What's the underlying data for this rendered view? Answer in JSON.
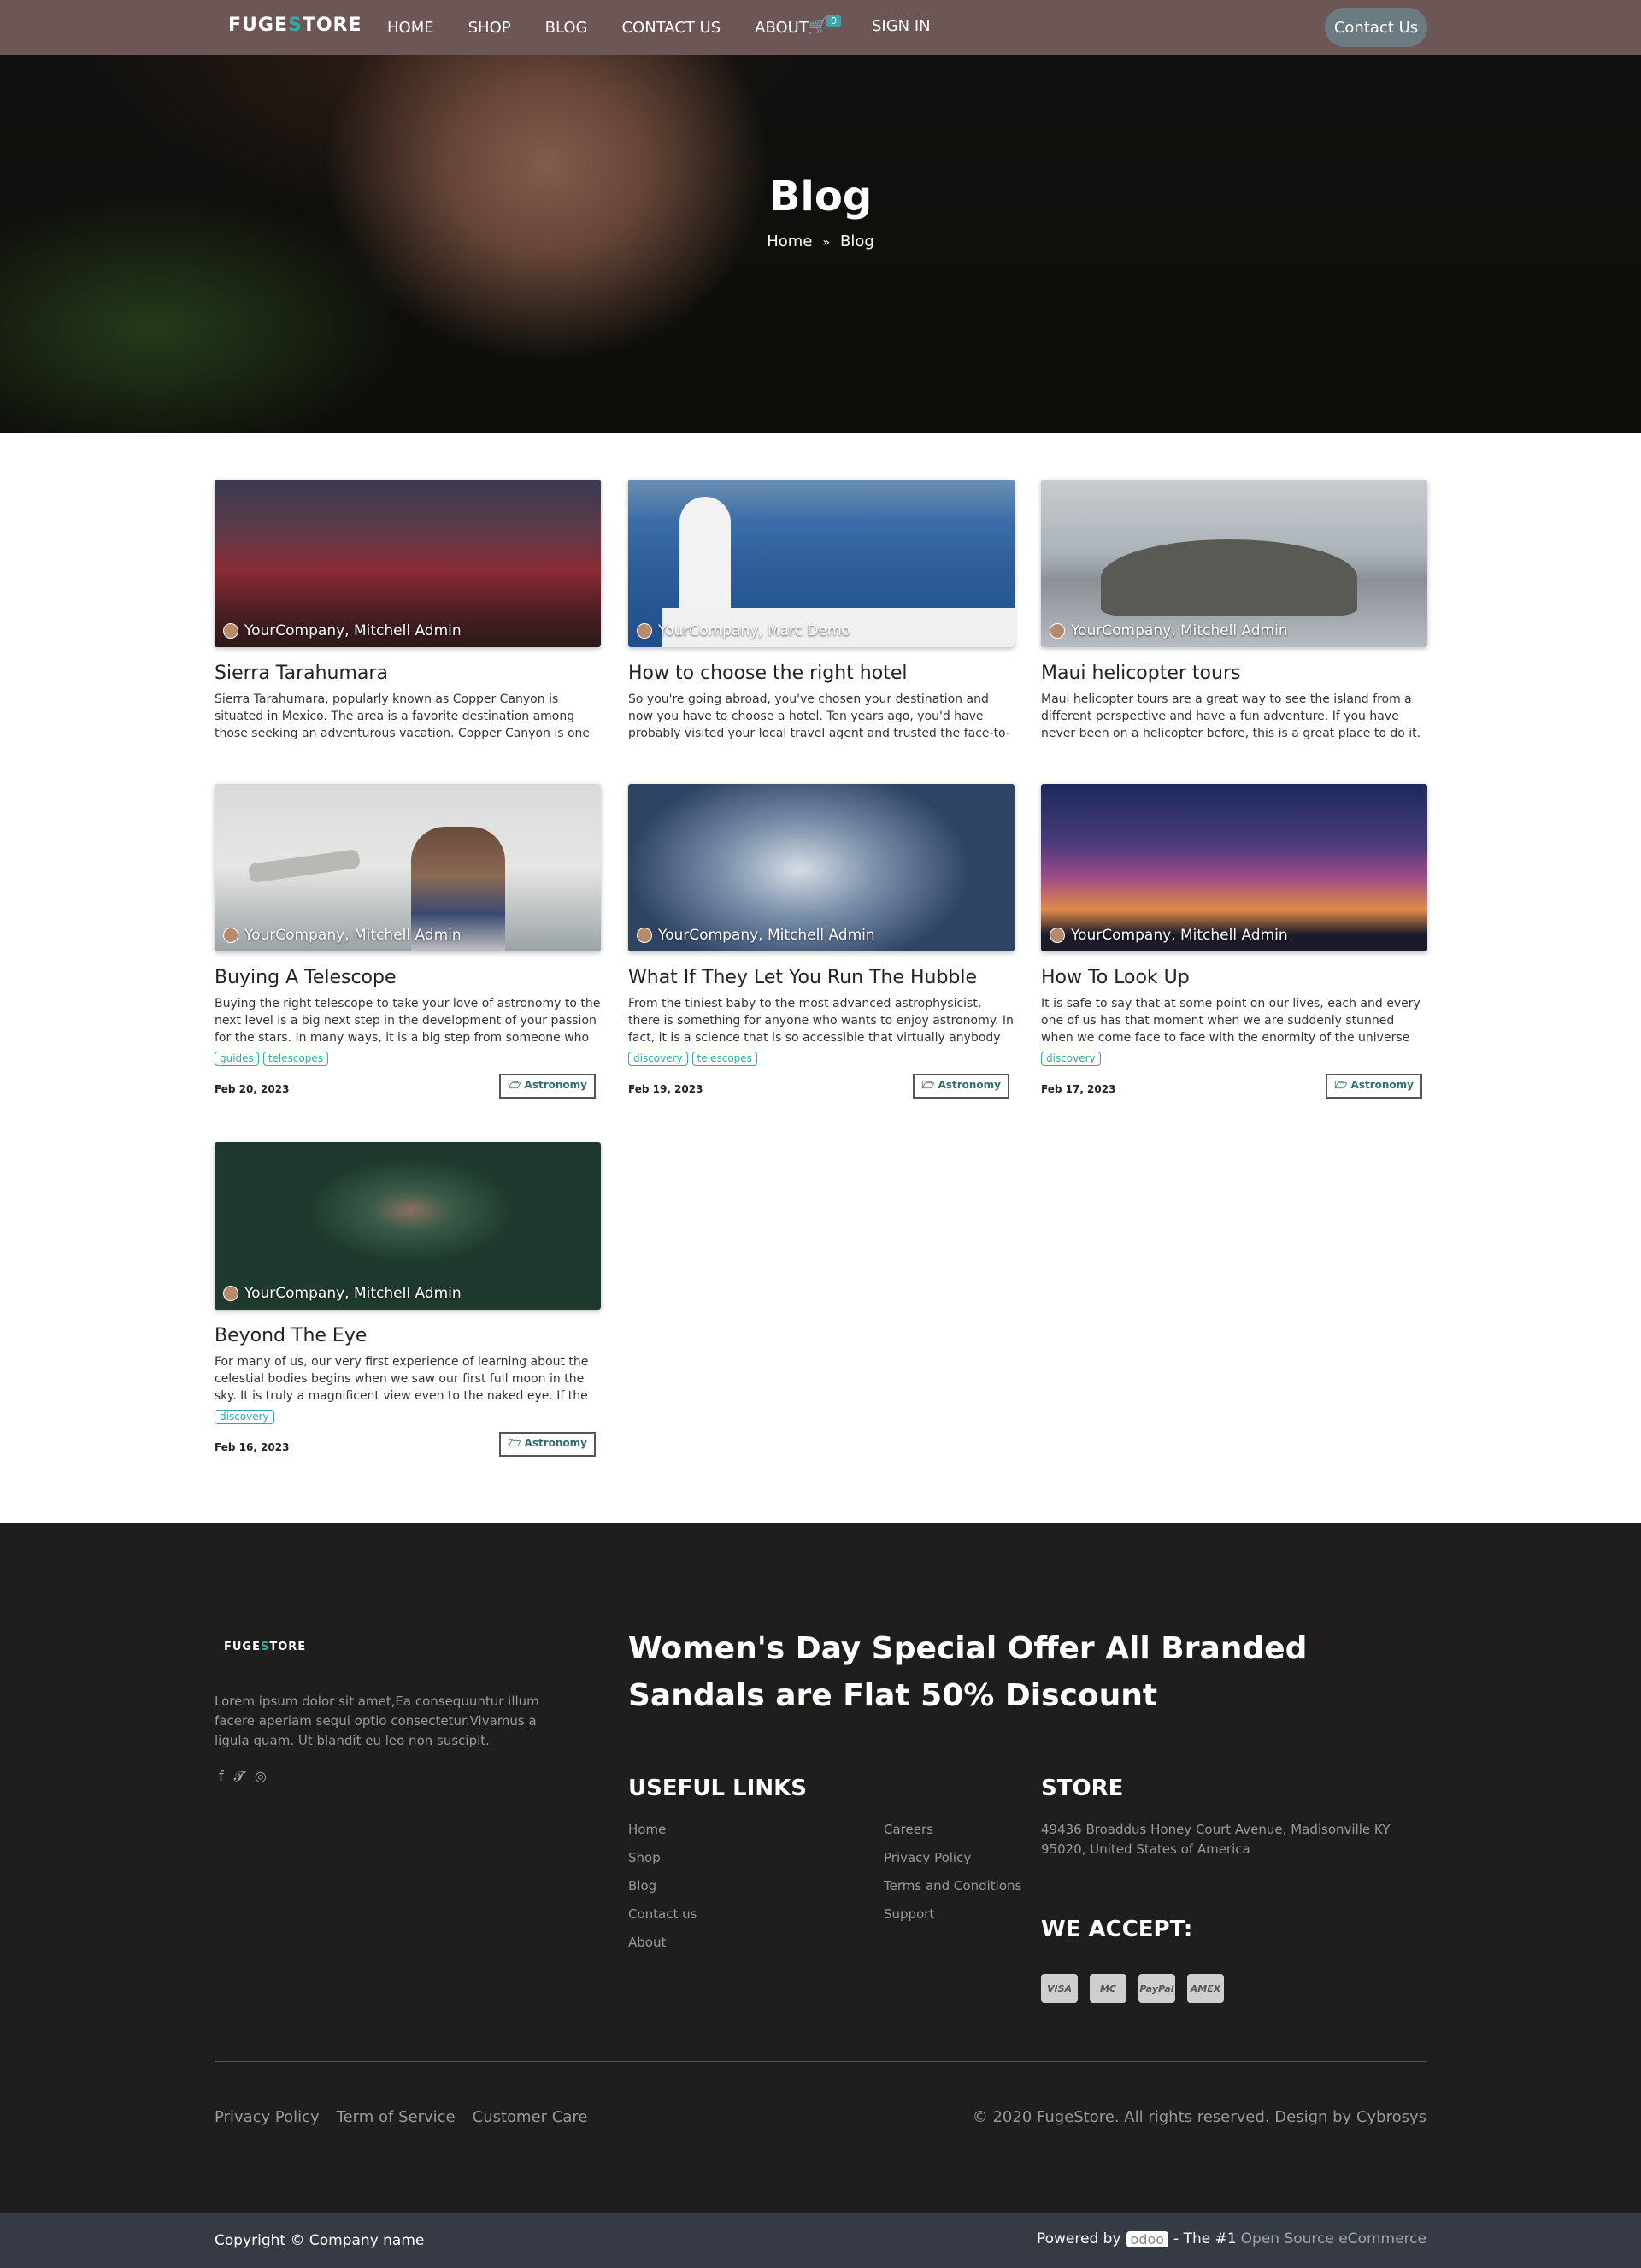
{
  "nav": {
    "logo_a": "FUGE",
    "logo_s": "S",
    "logo_b": "TORE",
    "items": [
      "HOME",
      "SHOP",
      "BLOG",
      "CONTACT US",
      "ABOUT"
    ],
    "cart_count": "0",
    "sign_in": "SIGN IN",
    "contact_button": "Contact Us"
  },
  "hero": {
    "title": "Blog",
    "breadcrumb_home": "Home",
    "breadcrumb_current": "Blog"
  },
  "posts": [
    {
      "author": "YourCompany, Mitchell Admin",
      "title": "Sierra Tarahumara",
      "excerpt": "Sierra Tarahumara, popularly known as Copper Canyon is situated in Mexico. The area is a favorite destination among those seeking an adventurous vacation. Copper Canyon is one of the six gorges in the...",
      "tags": [],
      "date": "",
      "category": ""
    },
    {
      "author": "YourCompany, Marc Demo",
      "title": "How to choose the right hotel",
      "excerpt": "So you're going abroad, you've chosen your destination and now you have to choose a hotel. Ten years ago, you'd have probably visited your local travel agent and trusted the face-to-face advice you we...",
      "tags": [],
      "date": "",
      "category": ""
    },
    {
      "author": "YourCompany, Mitchell Admin",
      "title": "Maui helicopter tours",
      "excerpt": "Maui helicopter tours are a great way to see the island from a different perspective and have a fun adventure. If you have never been on a helicopter before, this is a great place to do it. You will s...",
      "tags": [],
      "date": "",
      "category": ""
    },
    {
      "author": "YourCompany, Mitchell Admin",
      "title": "Buying A Telescope",
      "excerpt": "Buying the right telescope to take your love of astronomy to the next level is a big next step in the development of your passion for the stars. In many ways, it is a big step from someone who is just...",
      "tags": [
        "guides",
        "telescopes"
      ],
      "date": "Feb 20, 2023",
      "category": "Astronomy"
    },
    {
      "author": "YourCompany, Mitchell Admin",
      "title": "What If They Let You Run The Hubble",
      "excerpt": "From the tiniest baby to the most advanced astrophysicist, there is something for anyone who wants to enjoy astronomy. In fact, it is a science that is so accessible that virtually anybody can do it v...",
      "tags": [
        "discovery",
        "telescopes"
      ],
      "date": "Feb 19, 2023",
      "category": "Astronomy"
    },
    {
      "author": "YourCompany, Mitchell Admin",
      "title": "How To Look Up",
      "excerpt": "It is safe to say that at some point on our lives, each and every one of us has that moment when we are suddenly stunned when we come face to face with the enormity of the universe that we see in the ...",
      "tags": [
        "discovery"
      ],
      "date": "Feb 17, 2023",
      "category": "Astronomy"
    },
    {
      "author": "YourCompany, Mitchell Admin",
      "title": "Beyond The Eye",
      "excerpt": "For many of us, our very first experience of learning about the celestial bodies begins when we saw our first full moon in the sky. It is truly a magnificent view even to the naked eye. If the night i...",
      "tags": [
        "discovery"
      ],
      "date": "Feb 16, 2023",
      "category": "Astronomy"
    }
  ],
  "footer": {
    "logo_a": "FUGE",
    "logo_s": "S",
    "logo_b": "TORE",
    "about": "Lorem ipsum dolor sit amet,Ea consequuntur illum facere aperiam sequi optio consectetur.Vivamus a ligula quam. Ut blandit eu leo non suscipit.",
    "offer": "Women's Day Special Offer All Branded Sandals are Flat 50% Discount",
    "useful_links_title": "USEFUL LINKS",
    "links_col1": [
      "Home",
      "Shop",
      "Blog",
      "Contact us",
      "About"
    ],
    "links_col2": [
      "Careers",
      "Privacy Policy",
      "Terms and Conditions",
      "Support"
    ],
    "store_title": "STORE",
    "store_address": "49436 Broaddus Honey Court Avenue, Madisonville KY 95020, United States of America",
    "accept_title": "WE ACCEPT:",
    "payments": [
      "VISA",
      "MC",
      "PayPal",
      "AMEX"
    ],
    "bottom_links": [
      "Privacy Policy",
      "Term of Service",
      "Customer Care"
    ],
    "copyright": "© 2020 FugeStore. All rights reserved. Design by Cybrosys"
  },
  "bottom_bar": {
    "copyright": "Copyright © Company name",
    "powered_by": "Powered by",
    "odoo": "odoo",
    "the_1": "- The #1",
    "tagline": "Open Source eCommerce"
  }
}
